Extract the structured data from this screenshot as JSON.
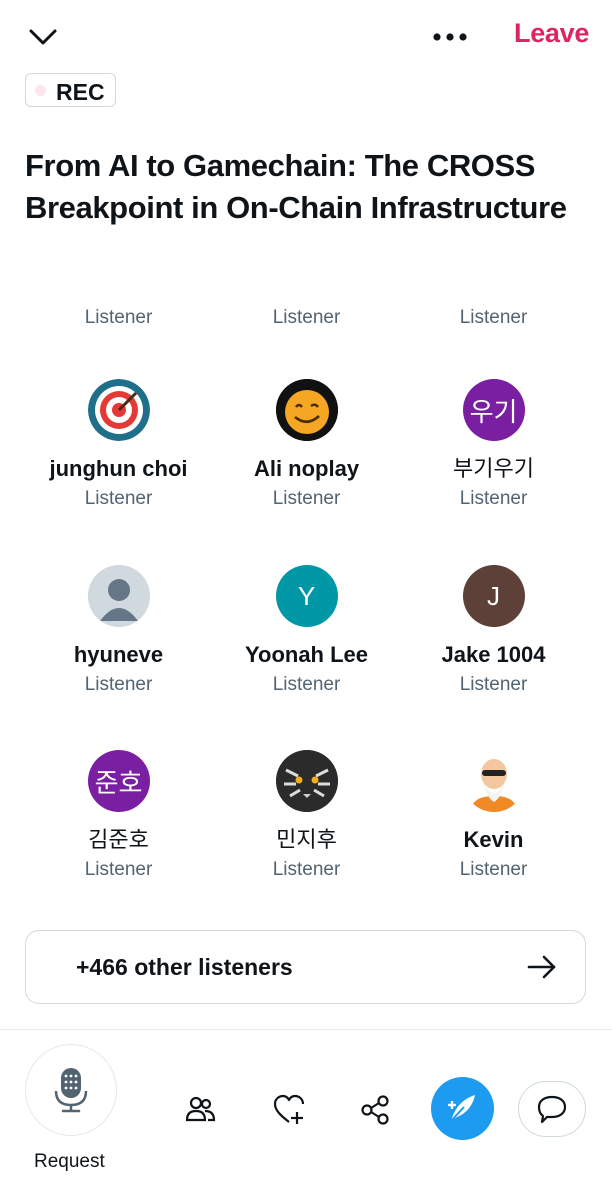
{
  "header": {
    "leave_label": "Leave",
    "rec_label": "REC",
    "title": "From AI to Gamechain: The CROSS Breakpoint in On-Chain Infrastructure"
  },
  "participants": [
    {
      "name": "",
      "role": "Listener"
    },
    {
      "name": "",
      "role": "Listener"
    },
    {
      "name": "",
      "role": "Listener"
    },
    {
      "name": "junghun choi",
      "role": "Listener",
      "avatar": "target-icon"
    },
    {
      "name": "Ali noplay",
      "role": "Listener",
      "avatar": "smiley-icon"
    },
    {
      "name": "부기우기",
      "role": "Listener",
      "avatar_text": "우기",
      "avatar_color": "#7b1fa2"
    },
    {
      "name": "hyuneve",
      "role": "Listener",
      "avatar": "default-user-icon"
    },
    {
      "name": "Yoonah Lee",
      "role": "Listener",
      "avatar_text": "Y",
      "avatar_color": "#0097a7"
    },
    {
      "name": "Jake 1004",
      "role": "Listener",
      "avatar_text": "J",
      "avatar_color": "#5d4037"
    },
    {
      "name": "김준호",
      "role": "Listener",
      "avatar_text": "준호",
      "avatar_color": "#7b1fa2"
    },
    {
      "name": "민지후",
      "role": "Listener",
      "avatar": "tiger-icon"
    },
    {
      "name": "Kevin",
      "role": "Listener",
      "avatar": "old-man-icon"
    }
  ],
  "others": {
    "label": "+466 other listeners"
  },
  "bottom_bar": {
    "request_label": "Request"
  },
  "colors": {
    "leave": "#e0245e",
    "accent": "#1d9bf0",
    "secondary_text": "#536471"
  }
}
